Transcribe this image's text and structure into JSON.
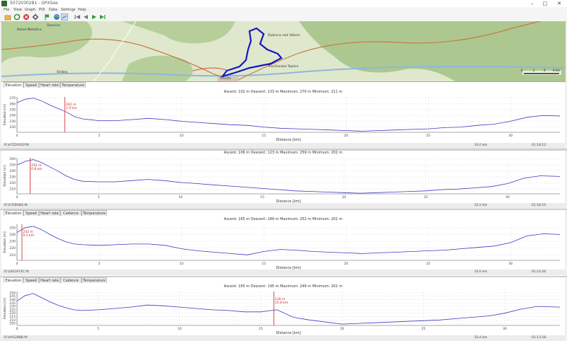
{
  "window": {
    "title": "5072030281 - GPXSee",
    "minimize": "–",
    "maximize": "□",
    "close": "✕"
  },
  "menu": [
    "File",
    "View",
    "Graph",
    "POI",
    "Data",
    "Settings",
    "Help"
  ],
  "toolbar": [
    "open-icon",
    "reload-icon",
    "close-file-icon",
    "settings-icon",
    "flag-icon",
    "map-icon",
    "graph-icon",
    "first-icon",
    "prev-icon",
    "next-icon",
    "last-icon"
  ],
  "map": {
    "labels": [
      "Dolné Motešice",
      "Slavnica",
      "Trenčianske Teplice",
      "Dubnica nad Váhom",
      "Trenčín",
      "Trenčianske Teplice",
      "Stribro",
      "Trenčín"
    ],
    "scale": {
      "ticks": [
        "0",
        "2",
        "4",
        "6 km"
      ]
    },
    "colors": {
      "land": "#d7e2c3",
      "forest": "#a9c890",
      "road": "#c77a44",
      "track": "#1515c8",
      "river": "#8fb6dc"
    }
  },
  "panels": [
    {
      "tabs": [
        "Elevation",
        "Speed",
        "Heart rate",
        "Temperature"
      ],
      "active_tab": "Elevation",
      "stats": "Ascent: 102 m  Descent: 133 m  Maximum: 270 m  Minimum: 211 m",
      "ylabel": "Elevation [m]",
      "xlabel": "Distance [km]",
      "yticks": [
        "270",
        "260",
        "250",
        "240",
        "230",
        "220"
      ],
      "xticks": [
        "0",
        "5",
        "10",
        "15",
        "20",
        "25",
        "30"
      ],
      "cursor_label": [
        "242 m",
        "2.9 km"
      ],
      "footer": {
        "file": "R:\\A7Z2H1EP.fit",
        "distance": "33.0 km",
        "time": "01:18:12"
      }
    },
    {
      "tabs": [],
      "active_tab": "",
      "stats": "Ascent: 106 m  Descent: 123 m  Maximum: 259 m  Minimum: 202 m",
      "ylabel": "Elevation [m]",
      "xlabel": "Distance [km]",
      "yticks": [
        "260",
        "250",
        "240",
        "230",
        "220",
        "210"
      ],
      "xticks": [
        "0",
        "5",
        "10",
        "15",
        "20",
        "25",
        "30"
      ],
      "cursor_label": [
        "252 m",
        "0.8 km"
      ],
      "footer": {
        "file": "R:\\A7EBAB4.fit",
        "distance": "33.2 km",
        "time": "01:18:15"
      }
    },
    {
      "tabs": [
        "Elevation",
        "Speed",
        "Heart rate",
        "Cadence",
        "Temperature"
      ],
      "active_tab": "Elevation",
      "stats": "Ascent: 165 m  Descent: 189 m  Maximum: 252 m  Minimum: 202 m",
      "ylabel": "Elevation [m]",
      "xlabel": "Distance [km]",
      "yticks": [
        "250",
        "240",
        "230",
        "220",
        "210"
      ],
      "xticks": [
        "0",
        "5",
        "10",
        "15",
        "20",
        "25",
        "30"
      ],
      "cursor_label": [
        "242 m",
        "0.3 km"
      ],
      "footer": {
        "file": "R:\\2AE3FF4C.fit",
        "distance": "33.0 km",
        "time": "01:14:26"
      }
    },
    {
      "tabs": [
        "Elevation",
        "Speed",
        "Heart rate",
        "Cadence",
        "Temperature"
      ],
      "active_tab": "Elevation",
      "stats": "Ascent: 165 m  Descent: 195 m  Maximum: 249 m  Minimum: 202 m",
      "ylabel": "Elevation [m]",
      "xlabel": "Distance [km]",
      "yticks": [
        "250",
        "245",
        "240",
        "235",
        "230",
        "225",
        "220",
        "215",
        "210",
        "205"
      ],
      "xticks": [
        "0",
        "5",
        "10",
        "15",
        "20",
        "25",
        "30"
      ],
      "cursor_label": [
        "216 m",
        "15.8 km"
      ],
      "footer": {
        "file": "R:\\A912B8B.fit",
        "distance": "33.4 km",
        "time": "01:13:18"
      }
    }
  ],
  "chart_data": [
    {
      "type": "line",
      "xlabel": "Distance [km]",
      "ylabel": "Elevation [m]",
      "xlim": [
        0,
        33.0
      ],
      "ylim": [
        211,
        272
      ],
      "cursor_x": 2.9,
      "x": [
        0,
        0.5,
        1,
        1.5,
        2,
        2.5,
        3,
        3.5,
        4,
        5,
        6,
        7,
        8,
        9,
        10,
        11,
        12,
        13,
        14,
        15,
        16,
        17,
        18,
        19,
        20,
        21,
        22,
        23,
        24,
        25,
        26,
        27,
        28,
        29,
        30,
        31,
        32,
        33
      ],
      "values": [
        262,
        268,
        270,
        265,
        258,
        252,
        246,
        238,
        234,
        231,
        231,
        233,
        235,
        233,
        230,
        228,
        226,
        224,
        223,
        220,
        218,
        217,
        216,
        215,
        214,
        213,
        214,
        215,
        216,
        217,
        219,
        220,
        223,
        225,
        230,
        237,
        240,
        239
      ]
    },
    {
      "type": "line",
      "xlabel": "Distance [km]",
      "ylabel": "Elevation [m]",
      "xlim": [
        0,
        33.2
      ],
      "ylim": [
        202,
        262
      ],
      "cursor_x": 0.8,
      "x": [
        0,
        0.5,
        1,
        1.5,
        2,
        2.5,
        3,
        3.5,
        4,
        5,
        6,
        7,
        8,
        9,
        10,
        11,
        12,
        13,
        14,
        15,
        16,
        17,
        18,
        19,
        20,
        21,
        22,
        23,
        24,
        25,
        26,
        27,
        28,
        29,
        30,
        31,
        32,
        33.2
      ],
      "values": [
        250,
        256,
        259,
        254,
        247,
        240,
        232,
        226,
        223,
        222,
        222,
        224,
        226,
        224,
        221,
        219,
        217,
        215,
        213,
        211,
        209,
        207,
        206,
        205,
        204,
        203,
        204,
        205,
        206,
        207,
        209,
        210,
        212,
        214,
        219,
        228,
        232,
        231
      ]
    },
    {
      "type": "line",
      "xlabel": "Distance [km]",
      "ylabel": "Elevation [m]",
      "xlim": [
        0,
        33.0
      ],
      "ylim": [
        202,
        255
      ],
      "cursor_x": 0.3,
      "x": [
        0,
        0.5,
        1,
        1.5,
        2,
        2.5,
        3,
        3.5,
        4,
        5,
        6,
        7,
        8,
        9,
        10,
        11,
        12,
        13,
        14,
        15,
        16,
        17,
        18,
        19,
        20,
        21,
        22,
        23,
        24,
        25,
        26,
        27,
        28,
        29,
        30,
        31,
        32,
        33
      ],
      "values": [
        243,
        250,
        252,
        247,
        240,
        234,
        229,
        226,
        225,
        224,
        225,
        226,
        226,
        224,
        219,
        216,
        214,
        212,
        210,
        215,
        218,
        217,
        215,
        214,
        213,
        212,
        213,
        214,
        215,
        216,
        217,
        219,
        221,
        223,
        228,
        238,
        241,
        240
      ]
    },
    {
      "type": "line",
      "xlabel": "Distance [km]",
      "ylabel": "Elevation [m]",
      "xlim": [
        0,
        33.4
      ],
      "ylim": [
        202,
        252
      ],
      "cursor_x": 15.8,
      "x": [
        0,
        0.5,
        1,
        1.5,
        2,
        2.5,
        3,
        3.5,
        4,
        5,
        6,
        7,
        8,
        9,
        10,
        11,
        12,
        13,
        14,
        15,
        16,
        17,
        18,
        19,
        20,
        21,
        22,
        23,
        24,
        25,
        26,
        27,
        28,
        29,
        30,
        31,
        32,
        33.4
      ],
      "values": [
        238,
        246,
        249,
        243,
        237,
        232,
        228,
        225,
        224,
        225,
        227,
        229,
        232,
        231,
        229,
        227,
        225,
        224,
        222,
        222,
        225,
        214,
        210,
        207,
        204,
        205,
        206,
        207,
        208,
        209,
        210,
        212,
        214,
        216,
        220,
        226,
        230,
        229
      ]
    }
  ]
}
